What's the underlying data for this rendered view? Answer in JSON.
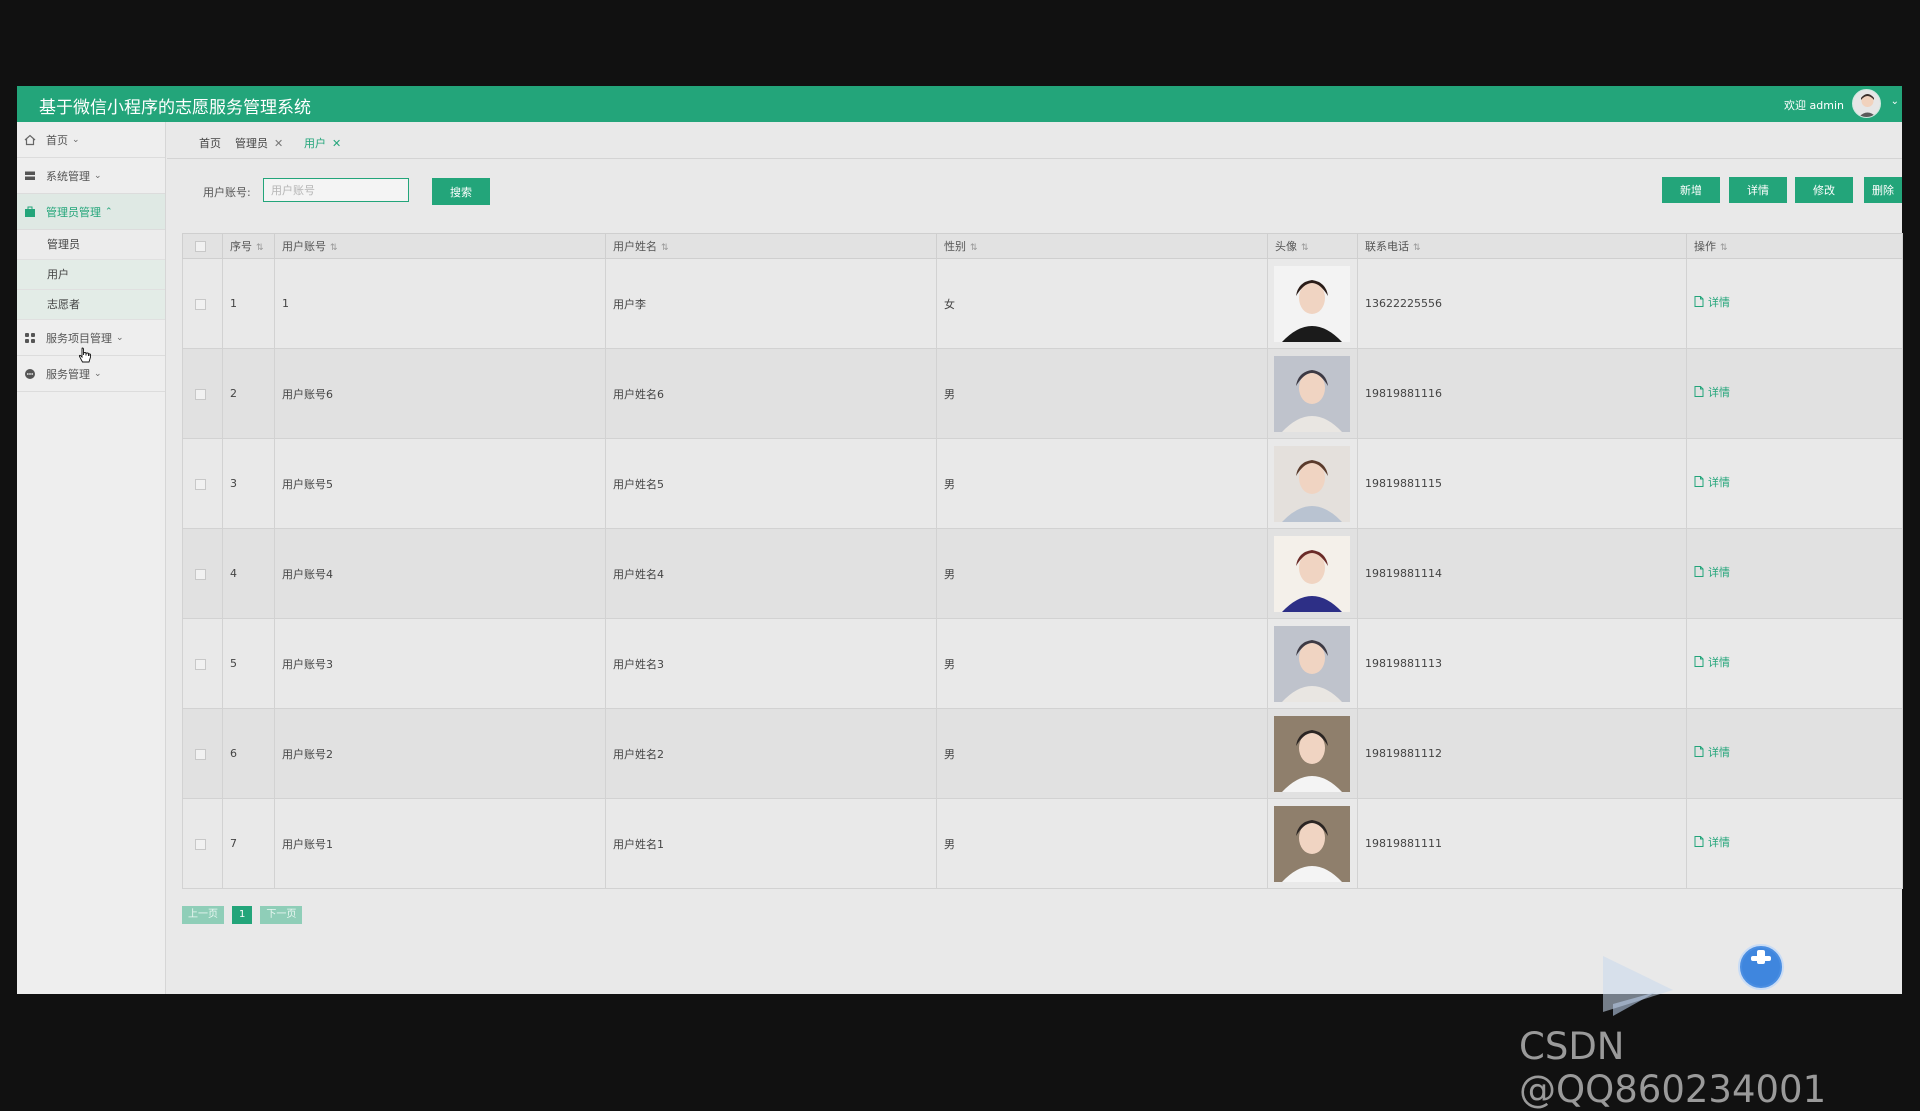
{
  "header": {
    "title": "基于微信小程序的志愿服务管理系统",
    "welcome": "欢迎 admin"
  },
  "sidebar": {
    "items": [
      {
        "label": "首页",
        "icon": "home-icon",
        "active": false
      },
      {
        "label": "系统管理",
        "icon": "system-icon",
        "active": false
      },
      {
        "label": "管理员管理",
        "icon": "admin-icon",
        "active": true,
        "expanded": true,
        "children": [
          {
            "label": "管理员"
          },
          {
            "label": "用户"
          },
          {
            "label": "志愿者"
          }
        ]
      },
      {
        "label": "服务项目管理",
        "icon": "grid-icon",
        "active": false
      },
      {
        "label": "服务管理",
        "icon": "service-icon",
        "active": false
      }
    ]
  },
  "tabs": [
    {
      "label": "首页",
      "closable": false
    },
    {
      "label": "管理员",
      "closable": true
    },
    {
      "label": "用户",
      "closable": true,
      "current": true
    }
  ],
  "search": {
    "label": "用户账号:",
    "placeholder": "用户账号",
    "button": "搜索"
  },
  "actions": [
    "新增",
    "详情",
    "修改",
    "删除"
  ],
  "table": {
    "columns": [
      "序号",
      "用户账号",
      "用户姓名",
      "性别",
      "头像",
      "联系电话",
      "操作"
    ],
    "rows": [
      {
        "index": "1",
        "account": "1",
        "name": "用户李",
        "gender": "女",
        "phone": "13622225556",
        "avatar": "woman-dark-top-photo"
      },
      {
        "index": "2",
        "account": "用户账号6",
        "name": "用户姓名6",
        "gender": "男",
        "phone": "19819881116",
        "avatar": "woman-short-hair-photo"
      },
      {
        "index": "3",
        "account": "用户账号5",
        "name": "用户姓名5",
        "gender": "男",
        "phone": "19819881115",
        "avatar": "young-man-photo"
      },
      {
        "index": "4",
        "account": "用户账号4",
        "name": "用户姓名4",
        "gender": "男",
        "phone": "19819881114",
        "avatar": "man-purple-shirt-photo"
      },
      {
        "index": "5",
        "account": "用户账号3",
        "name": "用户姓名3",
        "gender": "男",
        "phone": "19819881113",
        "avatar": "woman-short-hair-photo"
      },
      {
        "index": "6",
        "account": "用户账号2",
        "name": "用户姓名2",
        "gender": "男",
        "phone": "19819881112",
        "avatar": "man-white-shirt-photo"
      },
      {
        "index": "7",
        "account": "用户账号1",
        "name": "用户姓名1",
        "gender": "男",
        "phone": "19819881111",
        "avatar": "man-white-shirt-photo"
      }
    ],
    "row_action": "详情"
  },
  "pagination": {
    "prev": "上一页",
    "current": "1",
    "next": "下一页"
  },
  "watermark": "CSDN @QQ860234001",
  "colors": {
    "primary": "#23a57a",
    "background": "#e9e9e9",
    "frame": "#111111"
  }
}
